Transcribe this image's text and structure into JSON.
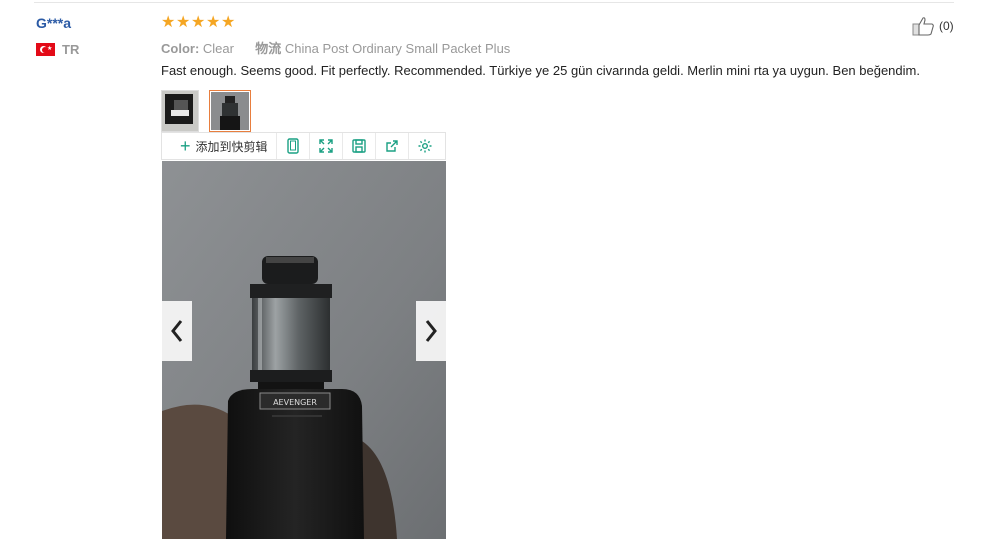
{
  "review": {
    "username": "G***a",
    "country_code": "TR",
    "rating": 5,
    "color_label": "Color:",
    "color_value": "Clear",
    "shipping_label": "物流",
    "shipping_value": "China Post Ordinary Small Packet Plus",
    "text": "Fast enough. Seems good. Fit perfectly. Recommended. Türkiye ye 25 gün civarında geldi. Merlin mini rta ya uygun. Ben beğendim.",
    "helpful_count": "(0)",
    "photo_label": "AEVENGER"
  },
  "toolbar": {
    "add_to_clip_label": "添加到快剪辑"
  },
  "icons": {
    "flag": "turkey-flag-icon",
    "star": "star-icon",
    "thumbs_up": "thumbs-up-icon",
    "plus": "plus-icon",
    "mobile": "phone-icon",
    "fullscreen": "expand-icon",
    "save": "save-icon",
    "share": "share-icon",
    "settings": "gear-icon",
    "prev": "chevron-left-icon",
    "next": "chevron-right-icon"
  },
  "colors": {
    "username": "#2b5aa5",
    "stars": "#f5a623",
    "thumb_selected_border": "#e87e3e",
    "toolbar_icon": "#1aa083"
  }
}
